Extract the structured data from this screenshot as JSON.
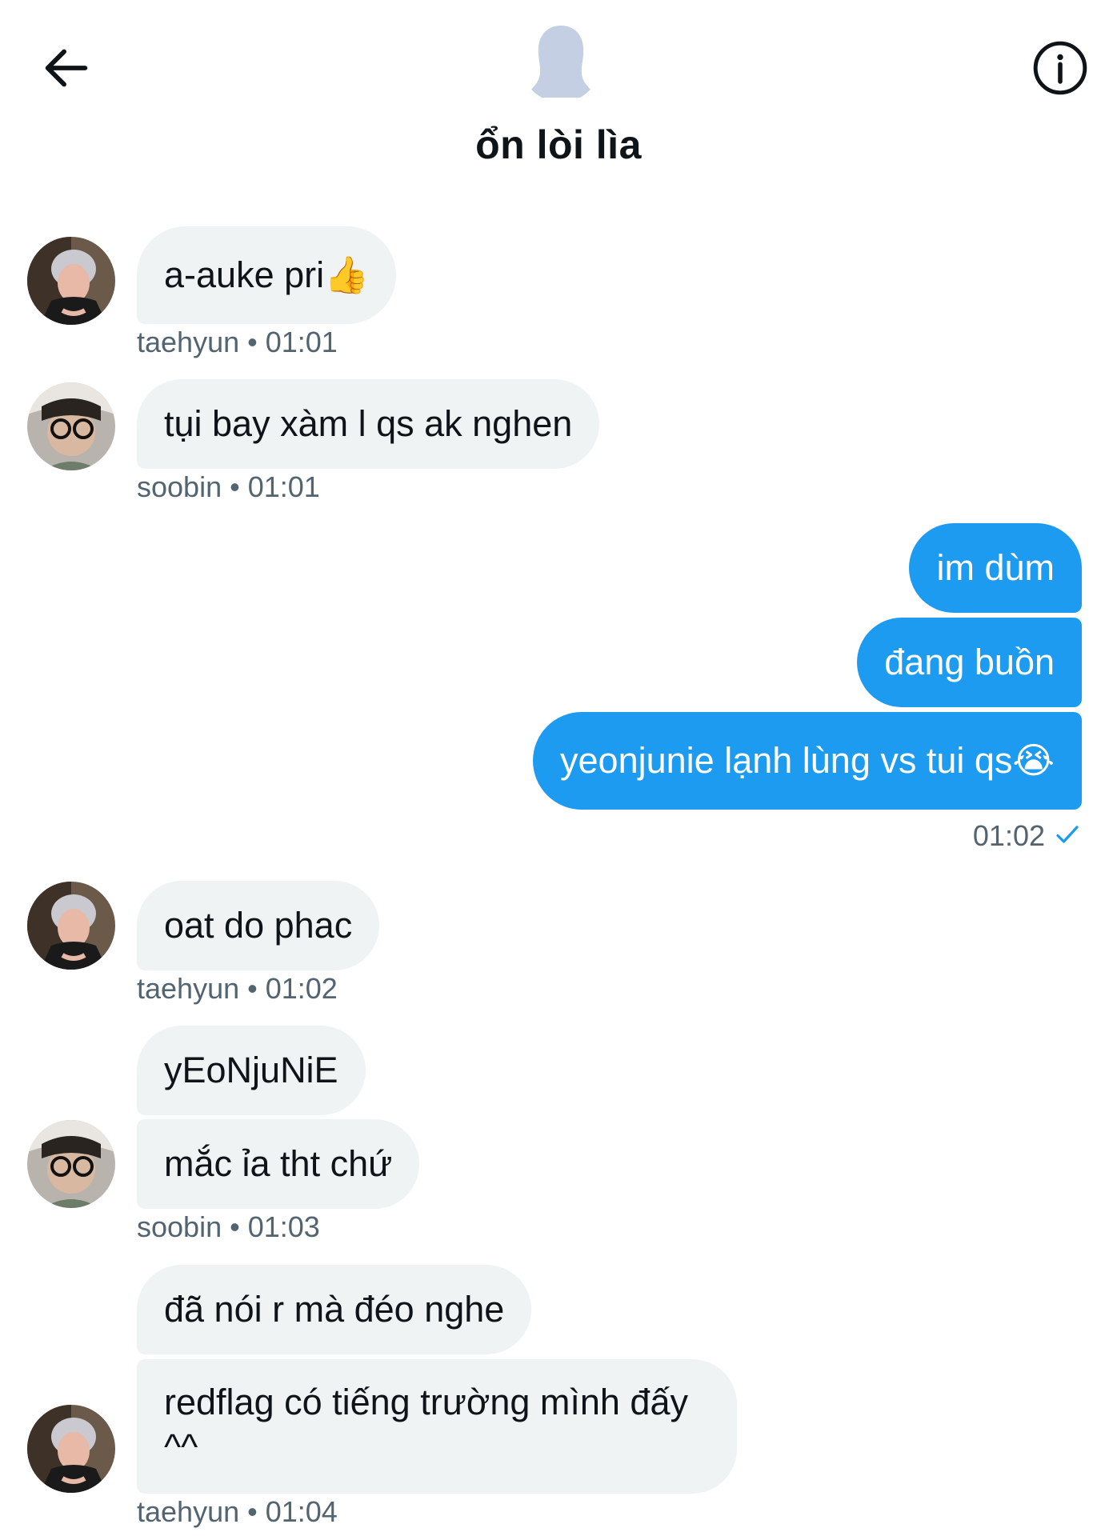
{
  "header": {
    "title": "ổn lòi lìa",
    "back_icon": "arrow-left-icon",
    "info_icon": "info-circle-icon",
    "group_avatar_icon": "default-person-avatar"
  },
  "colors": {
    "outgoing_bubble": "#1d9bf0",
    "incoming_bubble": "#eff3f4",
    "meta_text": "#536471",
    "check_mark": "#1d9bf0"
  },
  "messages": [
    {
      "sender": "taehyun",
      "direction": "incoming",
      "text": "a-auke pri👍",
      "time": "01:01",
      "meta": "taehyun • 01:01"
    },
    {
      "sender": "soobin",
      "direction": "incoming",
      "text": "tụi bay xàm l qs ak nghen",
      "time": "01:01",
      "meta": "soobin • 01:01"
    },
    {
      "sender": "me",
      "direction": "outgoing",
      "text": "im dùm"
    },
    {
      "sender": "me",
      "direction": "outgoing",
      "text": "đang buồn"
    },
    {
      "sender": "me",
      "direction": "outgoing",
      "text": "yeonjunie lạnh lùng vs tui qs😭",
      "time": "01:02",
      "meta": "01:02",
      "status_icon": "check-icon"
    },
    {
      "sender": "taehyun",
      "direction": "incoming",
      "text": "oat do phac",
      "time": "01:02",
      "meta": "taehyun • 01:02"
    },
    {
      "sender": "soobin",
      "direction": "incoming",
      "text": "yEoNjuNiE"
    },
    {
      "sender": "soobin",
      "direction": "incoming",
      "text": "mắc ỉa tht chứ",
      "time": "01:03",
      "meta": "soobin • 01:03"
    },
    {
      "sender": "taehyun",
      "direction": "incoming",
      "text": "đã nói r mà đéo nghe"
    },
    {
      "sender": "taehyun",
      "direction": "incoming",
      "text": "redflag có tiếng trường mình đấy ^^",
      "time": "01:04",
      "meta": "taehyun • 01:04"
    }
  ]
}
